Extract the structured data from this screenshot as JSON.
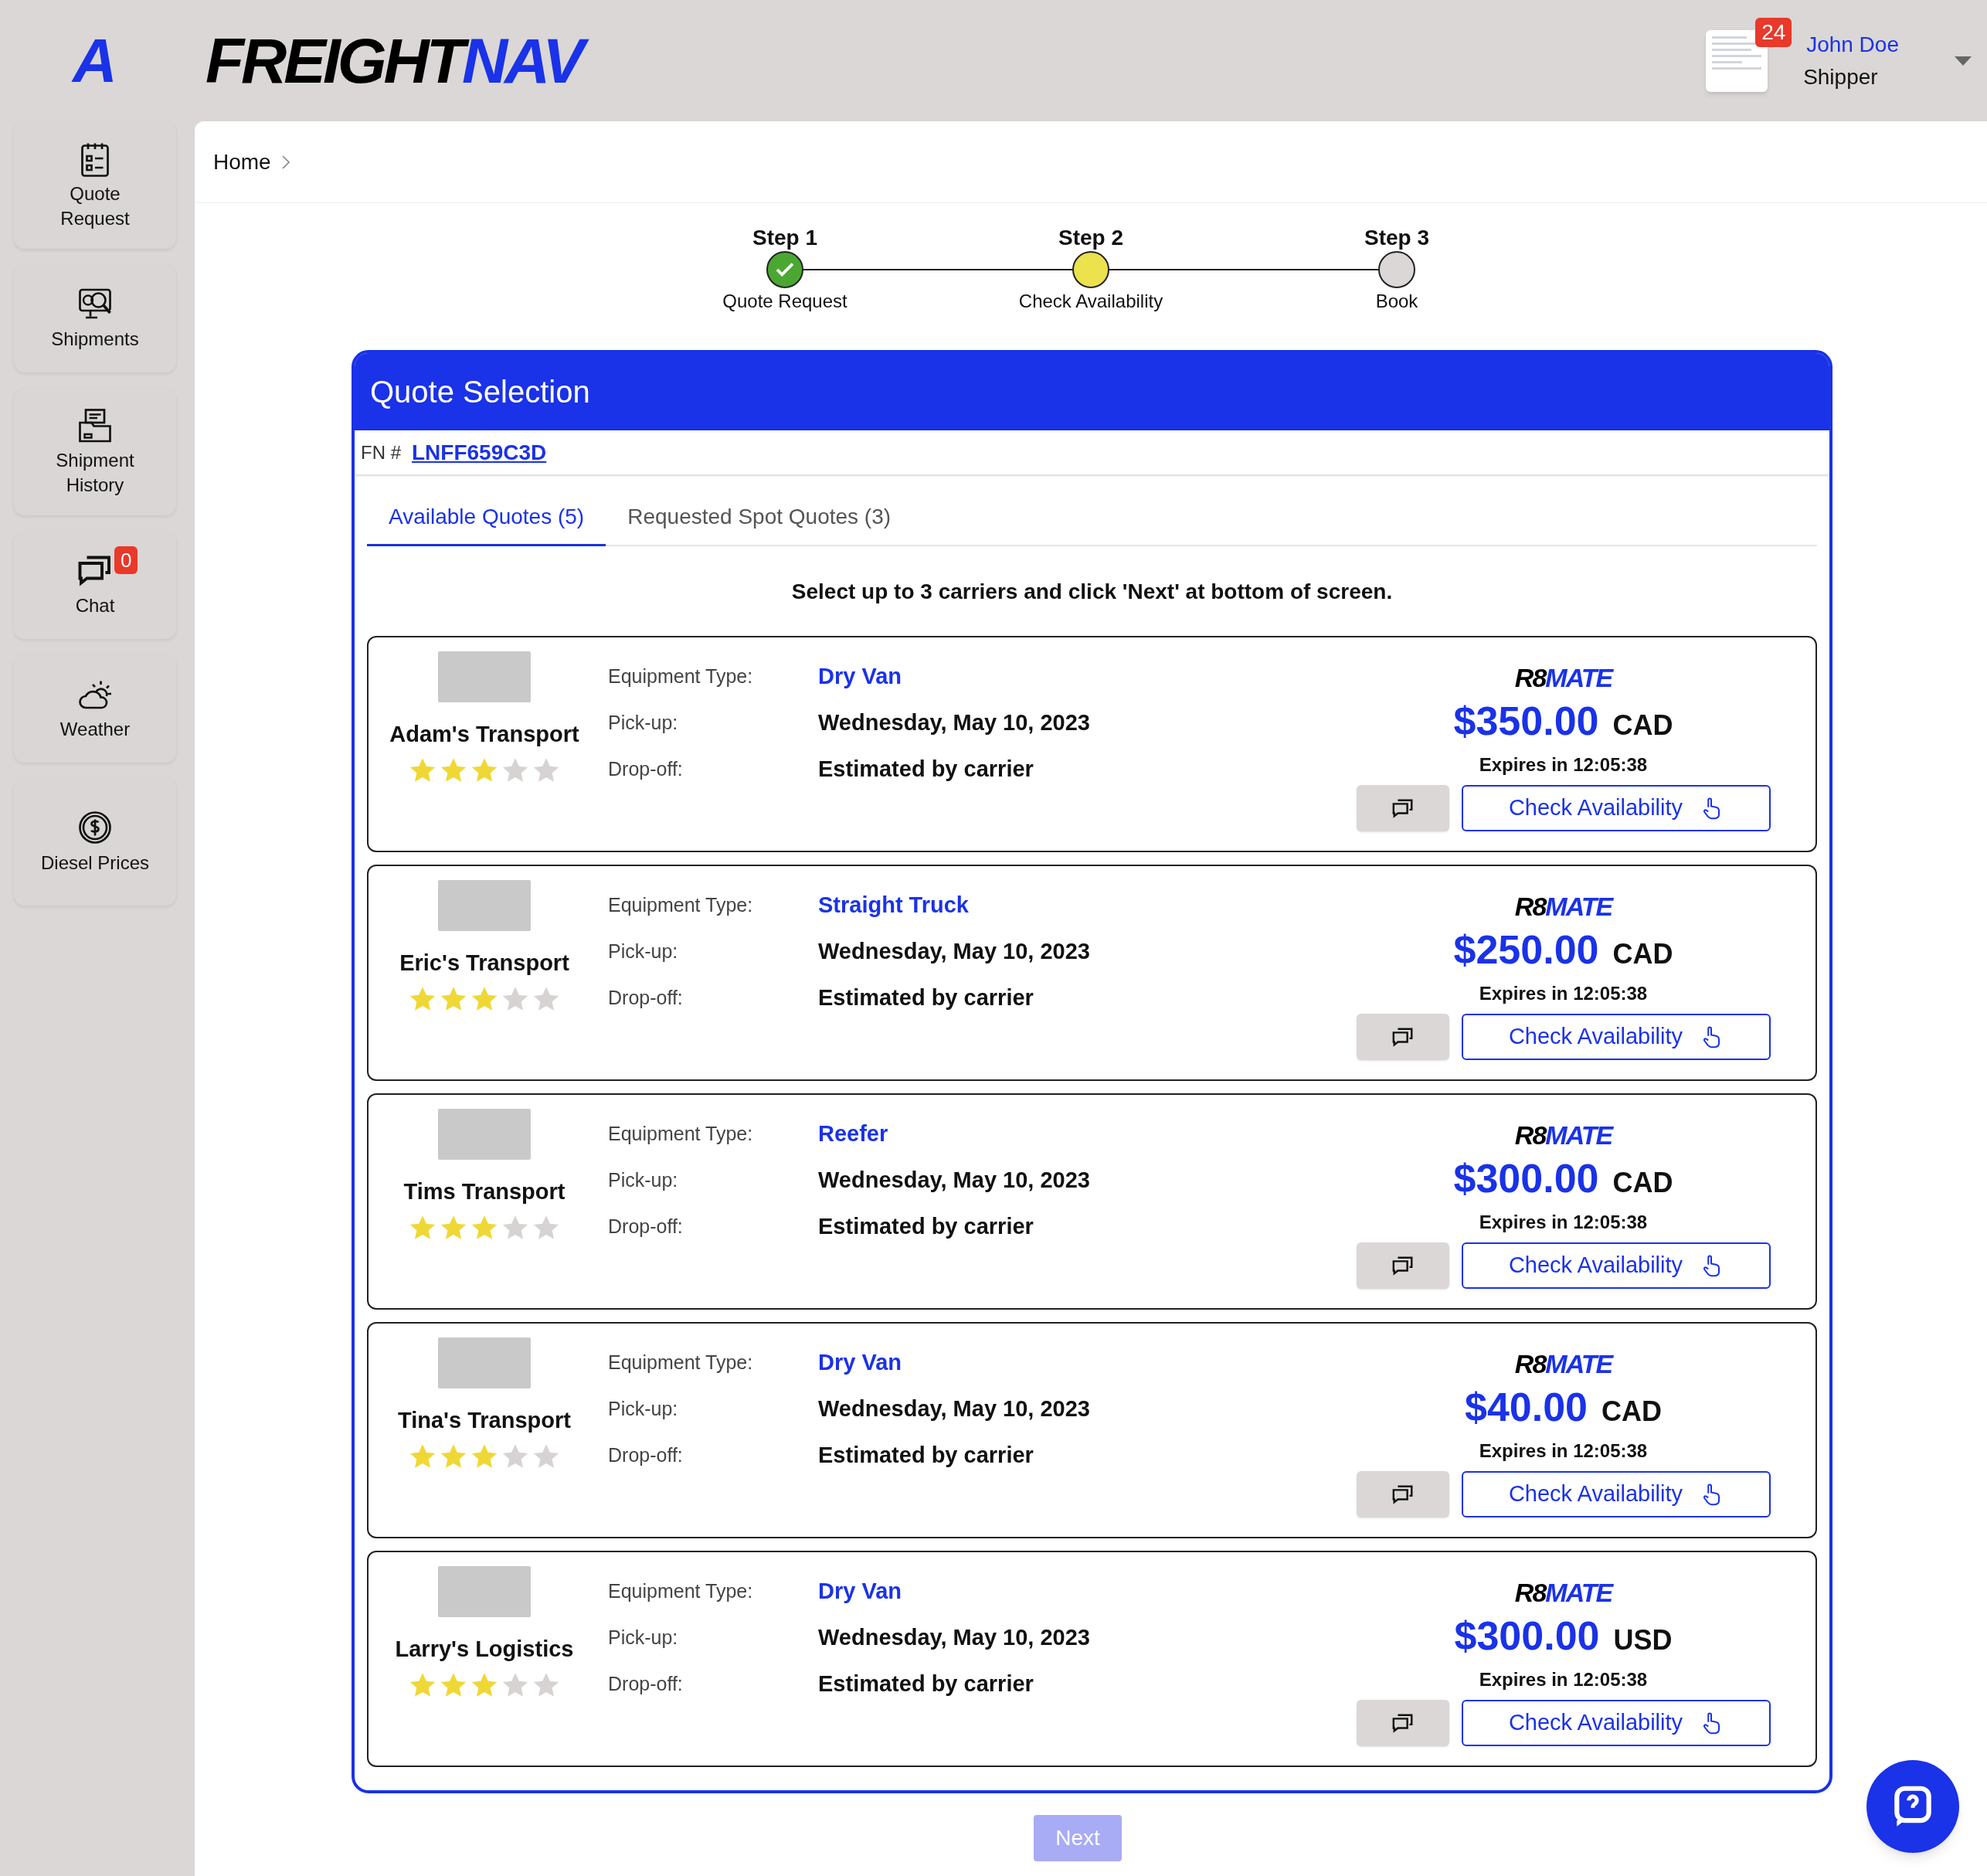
{
  "header": {
    "logo_mark": "A",
    "brand": [
      "FREIGHT",
      "NAV"
    ],
    "notifications": "24",
    "user": {
      "name": "John Doe",
      "role": "Shipper"
    }
  },
  "sidebar": {
    "items": [
      {
        "kind": "quote",
        "label": "Quote Request"
      },
      {
        "kind": "shipments",
        "label": "Shipments"
      },
      {
        "kind": "history",
        "label": "Shipment History"
      },
      {
        "kind": "chat",
        "label": "Chat",
        "badge": "0"
      },
      {
        "kind": "weather",
        "label": "Weather"
      },
      {
        "kind": "diesel",
        "label": "Diesel Prices"
      }
    ]
  },
  "breadcrumb": [
    "Home"
  ],
  "steps": [
    {
      "title": "Step 1",
      "label": "Quote Request",
      "kind": "done"
    },
    {
      "title": "Step 2",
      "label": "Check Availability",
      "kind": "current"
    },
    {
      "title": "Step 3",
      "label": "Book",
      "kind": "pending"
    }
  ],
  "panel": {
    "title": "Quote Selection",
    "fn_label": "FN #",
    "fn_number": "LNFF659C3D",
    "tabs": [
      {
        "label": "Available Quotes (5)",
        "selected": true
      },
      {
        "label": "Requested Spot Quotes (3)",
        "selected": false
      }
    ],
    "instruction": "Select up to 3 carriers and click 'Next' at bottom of screen.",
    "quotes": [
      {
        "carrier": "Adam's Transport",
        "labels": [
          "Equipment Type:",
          "Pick-up:",
          "Drop-off:"
        ],
        "stars": 3,
        "equipment": "Dry Van",
        "pickup": "Wednesday, May 10, 2023",
        "dropoff": "Estimated by carrier",
        "provider": [
          "R8",
          "MATE"
        ],
        "price": "$350.00",
        "currency": "CAD",
        "expires": "Expires in 12:05:38",
        "action": "Check Availability"
      },
      {
        "carrier": "Eric's Transport",
        "labels": [
          "Equipment Type:",
          "Pick-up:",
          "Drop-off:"
        ],
        "stars": 3,
        "equipment": "Straight Truck",
        "pickup": "Wednesday, May 10, 2023",
        "dropoff": "Estimated by carrier",
        "provider": [
          "R8",
          "MATE"
        ],
        "price": "$250.00",
        "currency": "CAD",
        "expires": "Expires in 12:05:38",
        "action": "Check Availability"
      },
      {
        "carrier": "Tims Transport",
        "labels": [
          "Equipment Type:",
          "Pick-up:",
          "Drop-off:"
        ],
        "stars": 3,
        "equipment": "Reefer",
        "pickup": "Wednesday, May 10, 2023",
        "dropoff": "Estimated by carrier",
        "provider": [
          "R8",
          "MATE"
        ],
        "price": "$300.00",
        "currency": "CAD",
        "expires": "Expires in 12:05:38",
        "action": "Check Availability"
      },
      {
        "carrier": "Tina's Transport",
        "labels": [
          "Equipment Type:",
          "Pick-up:",
          "Drop-off:"
        ],
        "stars": 3,
        "equipment": "Dry Van",
        "pickup": "Wednesday, May 10, 2023",
        "dropoff": "Estimated by carrier",
        "provider": [
          "R8",
          "MATE"
        ],
        "price": "$40.00",
        "currency": "CAD",
        "expires": "Expires in 12:05:38",
        "action": "Check Availability"
      },
      {
        "carrier": "Larry's Logistics",
        "labels": [
          "Equipment Type:",
          "Pick-up:",
          "Drop-off:"
        ],
        "stars": 3,
        "equipment": "Dry Van",
        "pickup": "Wednesday, May 10, 2023",
        "dropoff": "Estimated by carrier",
        "provider": [
          "R8",
          "MATE"
        ],
        "price": "$300.00",
        "currency": "USD",
        "expires": "Expires in 12:05:38",
        "action": "Check Availability"
      }
    ]
  },
  "next_button": {
    "label": "Next",
    "disabled": true
  }
}
